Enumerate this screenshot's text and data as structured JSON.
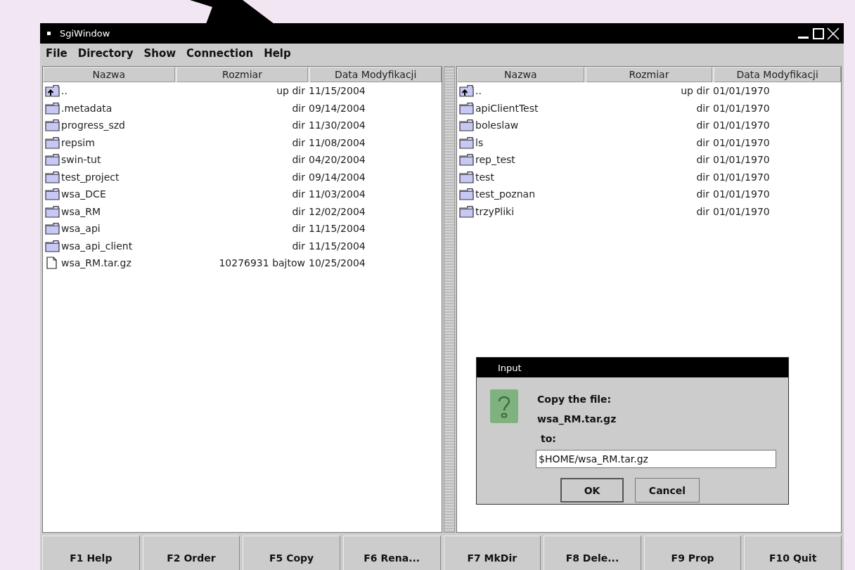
{
  "window": {
    "title": "SgiWindow"
  },
  "menu": [
    "File",
    "Directory",
    "Show",
    "Connection",
    "Help"
  ],
  "panels": [
    {
      "columns": [
        "Nazwa",
        "Rozmiar",
        "Data Modyfikacji"
      ],
      "rows": [
        {
          "kind": "up",
          "name": "..",
          "size": "up dir",
          "date": "11/15/2004"
        },
        {
          "kind": "dir",
          "name": ".metadata",
          "size": "dir",
          "date": "09/14/2004"
        },
        {
          "kind": "dir",
          "name": "progress_szd",
          "size": "dir",
          "date": "11/30/2004"
        },
        {
          "kind": "dir",
          "name": "repsim",
          "size": "dir",
          "date": "11/08/2004"
        },
        {
          "kind": "dir",
          "name": "swin-tut",
          "size": "dir",
          "date": "04/20/2004"
        },
        {
          "kind": "dir",
          "name": "test_project",
          "size": "dir",
          "date": "09/14/2004"
        },
        {
          "kind": "dir",
          "name": "wsa_DCE",
          "size": "dir",
          "date": "11/03/2004"
        },
        {
          "kind": "dir",
          "name": "wsa_RM",
          "size": "dir",
          "date": "12/02/2004"
        },
        {
          "kind": "dir",
          "name": "wsa_api",
          "size": "dir",
          "date": "11/15/2004"
        },
        {
          "kind": "dir",
          "name": "wsa_api_client",
          "size": "dir",
          "date": "11/15/2004"
        },
        {
          "kind": "file",
          "name": "wsa_RM.tar.gz",
          "size": "10276931 bajtow",
          "date": "10/25/2004"
        }
      ]
    },
    {
      "columns": [
        "Nazwa",
        "Rozmiar",
        "Data Modyfikacji"
      ],
      "rows": [
        {
          "kind": "up",
          "name": "..",
          "size": "up dir",
          "date": "01/01/1970"
        },
        {
          "kind": "dir",
          "name": "apiClientTest",
          "size": "dir",
          "date": "01/01/1970"
        },
        {
          "kind": "dir",
          "name": "boleslaw",
          "size": "dir",
          "date": "01/01/1970"
        },
        {
          "kind": "dir",
          "name": "ls",
          "size": "dir",
          "date": "01/01/1970"
        },
        {
          "kind": "dir",
          "name": "rep_test",
          "size": "dir",
          "date": "01/01/1970"
        },
        {
          "kind": "dir",
          "name": "test",
          "size": "dir",
          "date": "01/01/1970"
        },
        {
          "kind": "dir",
          "name": "test_poznan",
          "size": "dir",
          "date": "01/01/1970"
        },
        {
          "kind": "dir",
          "name": "trzyPliki",
          "size": "dir",
          "date": "01/01/1970"
        }
      ]
    }
  ],
  "dialog": {
    "title": "Input",
    "heading": "Copy the file:",
    "file_name": "wsa_RM.tar.gz",
    "target_label": "to:",
    "field": {
      "value": "$HOME/wsa_RM.tar.gz"
    },
    "buttons": [
      {
        "label": "OK",
        "default": true
      },
      {
        "label": "Cancel",
        "default": false
      }
    ]
  },
  "function_keys": [
    "F1 Help",
    "F2 Order",
    "F5 Copy",
    "F6 Rena...",
    "F7 MkDir",
    "F8 Dele...",
    "F9 Prop",
    "F10 Quit"
  ]
}
